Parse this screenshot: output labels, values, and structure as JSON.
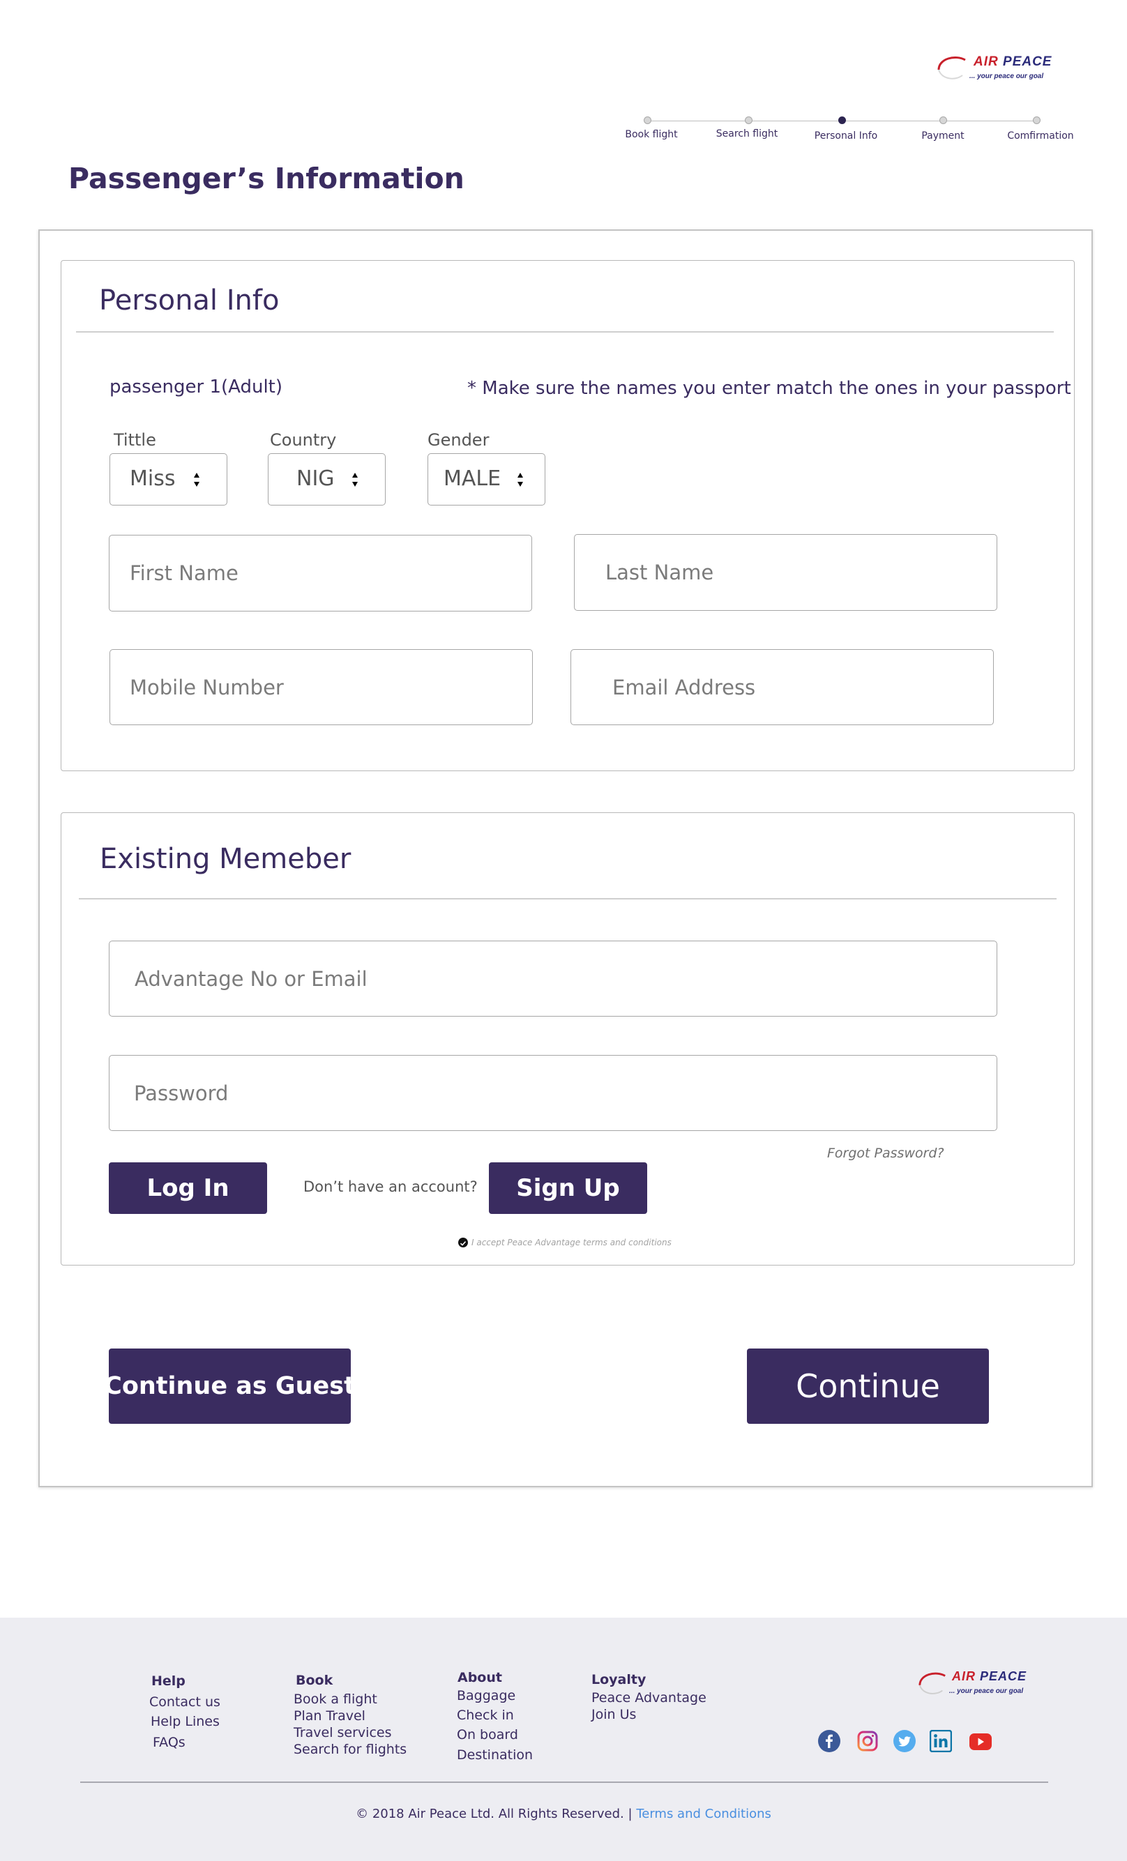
{
  "brand": {
    "name_first": "AIR",
    "name_second": "PEACE",
    "tagline": "... your peace our goal"
  },
  "stepper": {
    "steps": [
      {
        "label": "Book flight",
        "active": false
      },
      {
        "label": "Search flight",
        "active": false
      },
      {
        "label": "Personal Info",
        "active": true
      },
      {
        "label": "Payment",
        "active": false
      },
      {
        "label": "Comfirmation",
        "active": false
      }
    ]
  },
  "page": {
    "title": "Passenger’s Information"
  },
  "personal_info": {
    "title": "Personal Info",
    "passenger_label": "passenger 1(Adult)",
    "passport_note": "* Make sure the names you enter match the ones in your passport",
    "title_select": {
      "label": "Tittle",
      "value": "Miss"
    },
    "country_select": {
      "label": "Country",
      "value": "NIG"
    },
    "gender_select": {
      "label": "Gender",
      "value": "MALE"
    },
    "first_name_placeholder": "First Name",
    "last_name_placeholder": "Last Name",
    "mobile_placeholder": "Mobile Number",
    "email_placeholder": "Email Address"
  },
  "existing_member": {
    "title": "Existing Memeber",
    "advantage_placeholder": "Advantage No or Email",
    "password_placeholder": "Password",
    "forgot_password": "Forgot Password?",
    "login_label": "Log In",
    "no_account_text": "Don’t have an account?",
    "signup_label": "Sign Up",
    "terms_accept": "I accept Peace Advantage terms and conditions"
  },
  "actions": {
    "guest_label": "Continue as Guest",
    "continue_label": "Continue"
  },
  "footer": {
    "help": {
      "heading": "Help",
      "items": [
        "Contact us",
        "Help Lines",
        "FAQs"
      ]
    },
    "book": {
      "heading": "Book",
      "items": [
        "Book a flight",
        "Plan Travel",
        "Travel services",
        "Search for flights"
      ]
    },
    "about": {
      "heading": "About",
      "items": [
        "Baggage",
        "Check in",
        "On board",
        "Destination"
      ]
    },
    "loyalty": {
      "heading": "Loyalty",
      "items": [
        "Peace Advantage",
        "Join Us"
      ]
    },
    "social": [
      "facebook-icon",
      "instagram-icon",
      "twitter-icon",
      "linkedin-icon",
      "youtube-icon"
    ],
    "copyright": "© 2018 Air Peace Ltd. All Rights Reserved. |",
    "terms_link": "Terms and Conditions"
  },
  "colors": {
    "primary": "#3a2c60",
    "footer_bg": "#ededf2",
    "link": "#4a8fe0",
    "brand_red": "#c8202b"
  }
}
